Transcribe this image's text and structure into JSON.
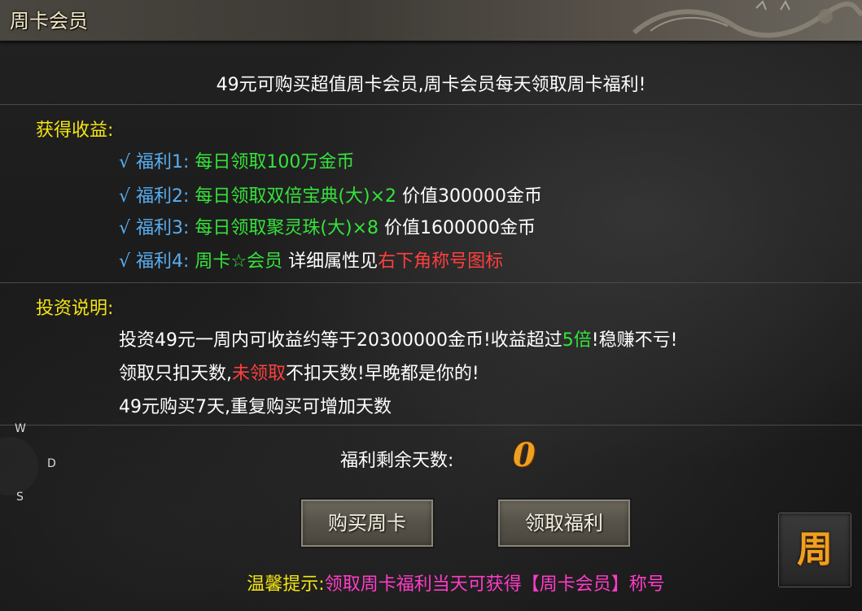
{
  "window": {
    "title": "周卡会员"
  },
  "intro": "49元可购买超值周卡会员,周卡会员每天领取周卡福利!",
  "benefits": {
    "heading": "获得收益:",
    "items": [
      {
        "label": "√ 福利1:",
        "text": "每日领取100万金币",
        "value": "",
        "extra": ""
      },
      {
        "label": "√ 福利2:",
        "text": "每日领取双倍宝典(大)×2",
        "value": " 价值300000金币",
        "extra": ""
      },
      {
        "label": "√ 福利3:",
        "text": "每日领取聚灵珠(大)×8",
        "value": " 价值1600000金币",
        "extra": ""
      },
      {
        "label": "√ 福利4:",
        "text": "周卡☆会员",
        "value": " 详细属性见",
        "extra": "右下角称号图标"
      }
    ]
  },
  "investment": {
    "heading": "投资说明:",
    "line1": {
      "a": "投资49元一周内可收益约等于20300000金币!收益超过",
      "b": "5倍",
      "c": "!稳赚不亏!"
    },
    "line2": {
      "a": "领取只扣天数,",
      "b": "未领取",
      "c": "不扣天数!早晚都是你的!"
    },
    "line3": "49元购买7天,重复购买可增加天数"
  },
  "remaining": {
    "label": "福利剩余天数:",
    "value": "0"
  },
  "buttons": {
    "buy": "购买周卡",
    "claim": "领取福利"
  },
  "tip": {
    "label": "温馨提示:",
    "text": "领取周卡福利当天可获得【周卡会员】称号"
  },
  "compass": {
    "w": "W",
    "d": "D",
    "s": "S"
  },
  "side_icon": {
    "char": "周"
  },
  "colors": {
    "heading": "#f3e512",
    "benefit_label": "#58aef2",
    "benefit_text": "#35e33b",
    "highlight_red": "#ff3f3f",
    "tip_text": "#ff3cc8",
    "days_value": "#f0a020"
  }
}
